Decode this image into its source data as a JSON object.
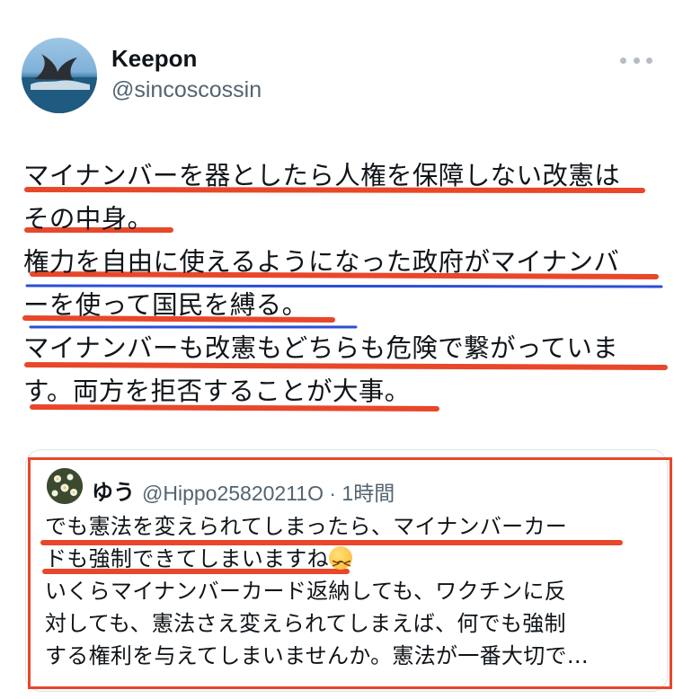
{
  "tweet": {
    "author_name": "Keepon",
    "author_handle": "@sincoscossin",
    "avatar_icon": "whale-tail-avatar-icon",
    "body_lines": [
      "マイナンバーを器としたら人権を保障しない改憲は",
      "その中身。",
      "権力を自由に使えるようになった政府がマイナンバ",
      "ーを使って国民を縛る。",
      "マイナンバーも改憲もどちらも危険で繋がっていま",
      "す。両方を拒否することが大事。"
    ]
  },
  "quoted_tweet": {
    "author_name": "ゆう",
    "author_handle_time": "@Hippo25820211O · 1時間",
    "avatar_icon": "flower-avatar-icon",
    "line1": "でも憲法を変えられてしまったら、マイナンバーカー",
    "line2": "ドも強制できてしまいますね",
    "emoji_icon": "persevering-face-emoji",
    "line3": "いくらマイナンバーカード返納しても、ワクチンに反",
    "line4": "対しても、憲法さえ変えられてしまえば、何でも強制",
    "line5": "する権利を与えてしまいませんか。憲法が一番大切で…"
  },
  "colors": {
    "handle_gray": "#536471",
    "annotation_red": "#e8472a",
    "annotation_blue": "#2a4fd6"
  }
}
